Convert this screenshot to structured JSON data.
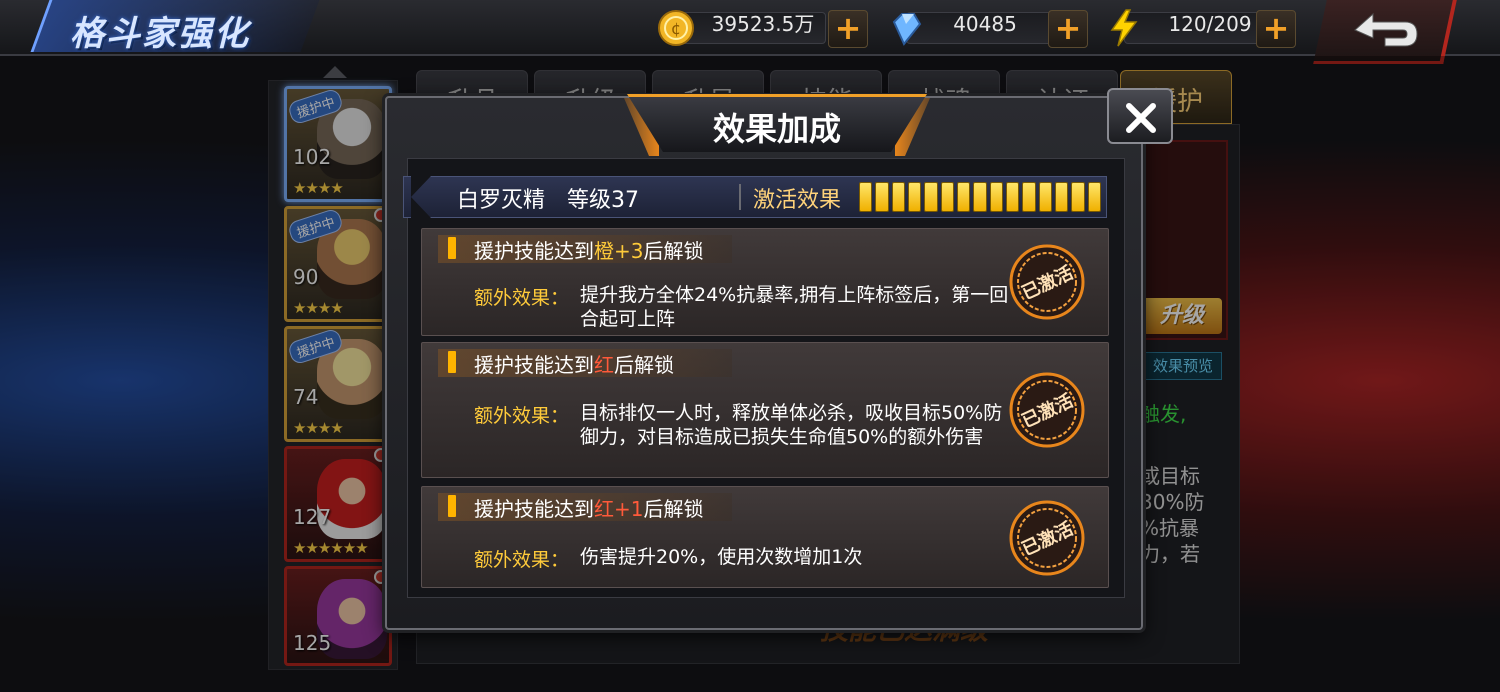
{
  "page_title": "格斗家强化",
  "resources": {
    "coins": "39523.5万",
    "diamonds": "40485",
    "stamina": "120/209",
    "plus_label": "+"
  },
  "hero_list": [
    {
      "level": "102",
      "stars": "★★★★",
      "tag": "援护中"
    },
    {
      "level": "90",
      "stars": "★★★★",
      "tag": "援护中"
    },
    {
      "level": "74",
      "stars": "★★★★",
      "tag": "援护中"
    },
    {
      "level": "127",
      "stars": "★★★★★★"
    },
    {
      "level": "125",
      "stars": ""
    }
  ],
  "background": {
    "tabs": [
      "升品",
      "升级",
      "升星",
      "技能",
      "战魂",
      "认证",
      "援护"
    ],
    "upgrade_label": "升级",
    "preview_label": "效果预览",
    "side_lines": [
      "触发,",
      "或目标",
      "30%防",
      "%抗暴",
      "力，若"
    ],
    "banner": "技能已达满级"
  },
  "dialog": {
    "title": "效果加成",
    "hero_name": "白罗灭精",
    "hero_level": "等级37",
    "activate_label": "激活效果",
    "activation_segments": 15,
    "stamp_text": "已激活",
    "extra_label": "额外效果：",
    "rows": [
      {
        "title_pre": "援护技能达到",
        "title_hl": "橙+3",
        "title_post": "后解锁",
        "text": "提升我方全体24%抗暴率,拥有上阵标签后，第一回合起可上阵"
      },
      {
        "title_pre": "援护技能达到",
        "title_hl": "红",
        "title_post": "后解锁",
        "text": "目标排仅一人时，释放单体必杀，吸收目标50%防御力，对目标造成已损失生命值50%的额外伤害"
      },
      {
        "title_pre": "援护技能达到",
        "title_hl": "红+1",
        "title_post": "后解锁",
        "text": "伤害提升20%，使用次数增加1次"
      }
    ]
  },
  "colors": {
    "accent_gold": "#ffcb3a",
    "accent_red": "#ff5a3a",
    "stamp_orange": "#e8861c"
  }
}
